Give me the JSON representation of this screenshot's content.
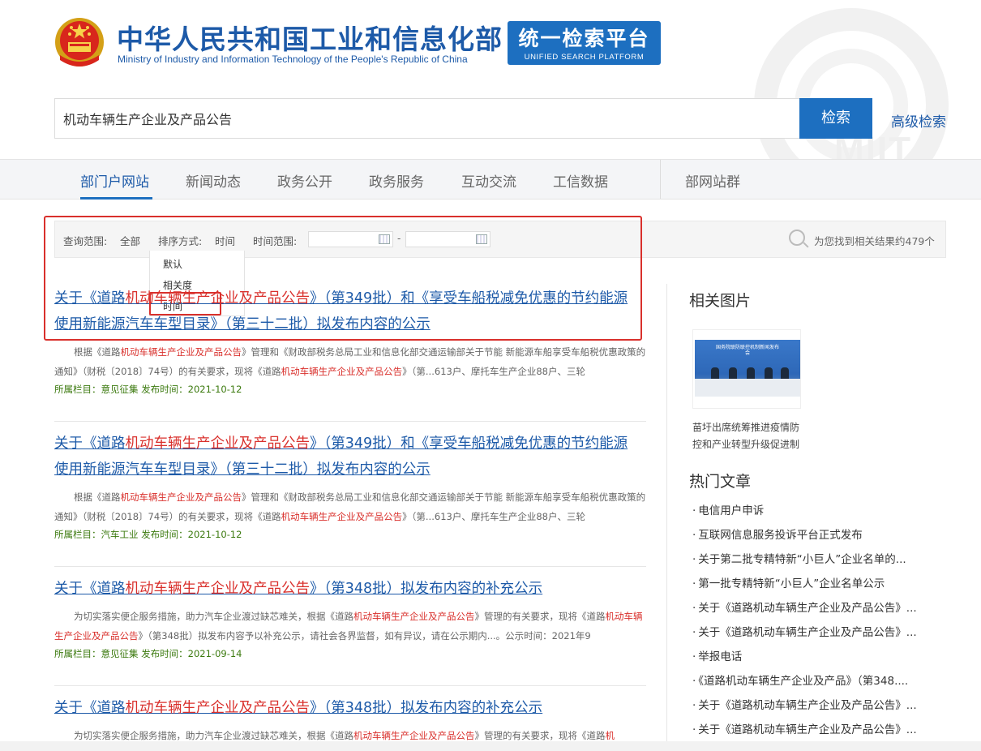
{
  "header": {
    "brand_cn": "中华人民共和国工业和信息化部",
    "brand_en": "Ministry of Industry and Information Technology of the People's Republic of China",
    "platform_cn": "统一检索平台",
    "platform_en": "UNIFIED SEARCH PLATFORM",
    "watermark": "MIIT"
  },
  "search": {
    "value": "机动车辆生产企业及产品公告",
    "button": "检索",
    "advanced": "高级检索"
  },
  "nav": {
    "items": [
      "部门户网站",
      "新闻动态",
      "政务公开",
      "政务服务",
      "互动交流",
      "工信数据",
      "部网站群"
    ],
    "active": "部门户网站"
  },
  "filter": {
    "scope_label": "查询范围:",
    "scope_value": "全部",
    "sort_label": "排序方式:",
    "sort_value": "时间",
    "time_label": "时间范围:",
    "date_sep": "-",
    "result_count": "为您找到相关结果约479个",
    "sort_options": [
      "默认",
      "相关度",
      "时间"
    ]
  },
  "results": [
    {
      "title_parts": [
        "关于《道路",
        "机动车辆生产企业及产品公告",
        "》（第349批）和《享受车船税减免优惠的节约能源 使用新能源汽车车型目录》（第三十二批）拟发布内容的公示"
      ],
      "summary_parts": [
        "根据《道路",
        "机动车辆生产企业及产品公告",
        "》管理和《财政部税务总局工业和信息化部交通运输部关于节能 新能源车船享受车船税优惠政策的通知》（财税〔2018〕74号）的有关要求，现将《道路",
        "机动车辆生产企业及产品公告",
        "》（第...613户、摩托车生产企业88户、三轮"
      ],
      "meta": "所属栏目：意见征集 发布时间：2021-10-12"
    },
    {
      "title_parts": [
        "关于《道路",
        "机动车辆生产企业及产品公告",
        "》（第349批）和《享受车船税减免优惠的节约能源 使用新能源汽车车型目录》（第三十二批）拟发布内容的公示"
      ],
      "summary_parts": [
        "根据《道路",
        "机动车辆生产企业及产品公告",
        "》管理和《财政部税务总局工业和信息化部交通运输部关于节能 新能源车船享受车船税优惠政策的通知》（财税〔2018〕74号）的有关要求，现将《道路",
        "机动车辆生产企业及产品公告",
        "》（第...613户、摩托车生产企业88户、三轮"
      ],
      "meta": "所属栏目：汽车工业 发布时间：2021-10-12"
    },
    {
      "title_parts": [
        "关于《道路",
        "机动车辆生产企业及产品公告",
        "》（第348批）拟发布内容的补充公示"
      ],
      "summary_parts": [
        "为切实落实便企服务措施，助力汽车企业渡过缺芯难关，根据《道路",
        "机动车辆生产企业及产品公告",
        "》管理的有关要求，现将《道路",
        "机动车辆生产企业及产品公告",
        "》（第348批）拟发布内容予以补充公示，请社会各界监督，如有异议，请在公示期内...。公示时间：2021年9"
      ],
      "meta": "所属栏目：意见征集 发布时间：2021-09-14"
    },
    {
      "title_parts": [
        "关于《道路",
        "机动车辆生产企业及产品公告",
        "》（第348批）拟发布内容的补充公示"
      ],
      "summary_parts": [
        "为切实落实便企服务措施，助力汽车企业渡过缺芯难关，根据《道路",
        "机动车辆生产企业及产品公告",
        "》管理的有关要求，现将《道路",
        "机",
        ""
      ],
      "meta": ""
    }
  ],
  "sidebar": {
    "images_title": "相关图片",
    "thumb_banner": "国务院联防联控机制新闻发布会",
    "image_caption": "苗圩出席统筹推进疫情防控和产业转型升级促进制",
    "hot_title": "热门文章",
    "hot_items": [
      "电信用户申诉",
      "互联网信息服务投诉平台正式发布",
      "关于第二批专精特新“小巨人”企业名单的...",
      "第一批专精特新“小巨人”企业名单公示",
      "关于《道路机动车辆生产企业及产品公告》...",
      "关于《道路机动车辆生产企业及产品公告》...",
      "举报电话",
      "《道路机动车辆生产企业及产品》（第348....",
      "关于《道路机动车辆生产企业及产品公告》...",
      "关于《道路机动车辆生产企业及产品公告》..."
    ]
  },
  "colors": {
    "brand_blue": "#1d5aa8",
    "button_blue": "#1d6fc0",
    "highlight_red": "#d9302c",
    "meta_green": "#3c7a0f"
  }
}
